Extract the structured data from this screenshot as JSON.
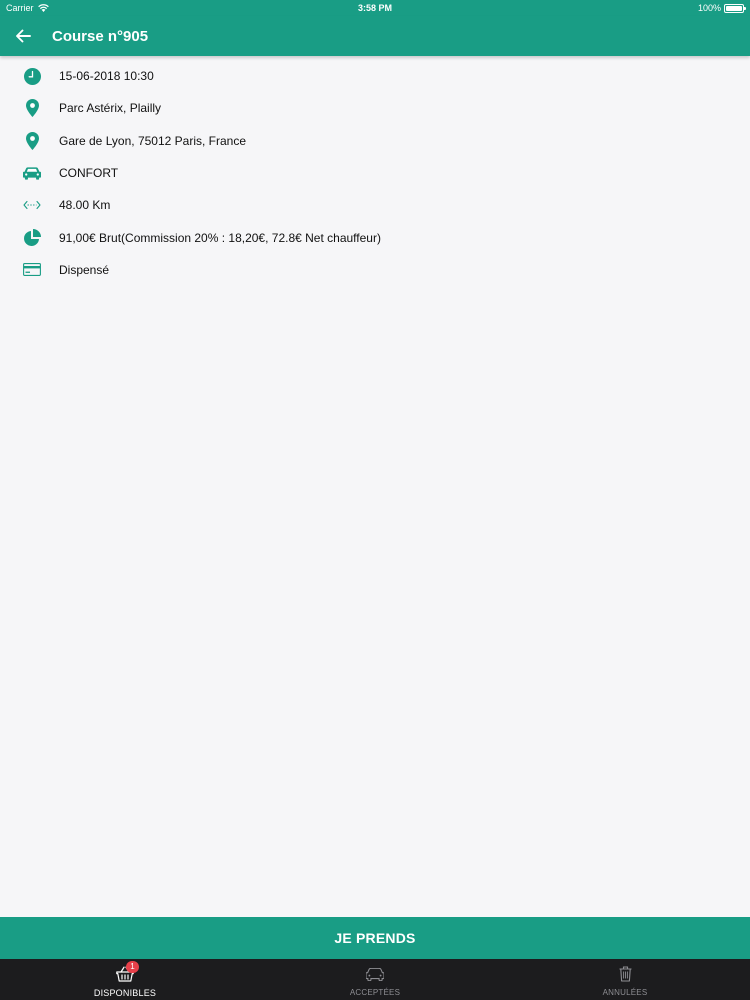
{
  "status_bar": {
    "carrier": "Carrier",
    "time": "3:58 PM",
    "battery": "100%"
  },
  "header": {
    "title": "Course n°905",
    "back_icon": "arrow-left-icon"
  },
  "details": {
    "items": [
      {
        "icon": "clock-icon",
        "text": "15-06-2018 10:30"
      },
      {
        "icon": "location-pin-icon",
        "text": "Parc Astérix, Plailly"
      },
      {
        "icon": "location-pin-icon",
        "text": "Gare de Lyon, 75012 Paris, France"
      },
      {
        "icon": "car-icon",
        "text": "CONFORT"
      },
      {
        "icon": "distance-icon",
        "text": "48.00 Km"
      },
      {
        "icon": "pie-chart-icon",
        "text": "91,00€ Brut(Commission 20% : 18,20€, 72.8€ Net chauffeur)"
      },
      {
        "icon": "credit-card-icon",
        "text": "Dispensé"
      }
    ]
  },
  "action": {
    "label": "JE PRENDS"
  },
  "tabs": [
    {
      "label": "DISPONIBLES",
      "icon": "basket-icon",
      "badge": "1",
      "active": true
    },
    {
      "label": "ACCEPTÉES",
      "icon": "car-icon",
      "active": false
    },
    {
      "label": "ANNULÉES",
      "icon": "trash-icon",
      "active": false
    }
  ],
  "colors": {
    "primary": "#199d85",
    "background": "#f6f6f8",
    "tab_bar": "#1c1c1e",
    "badge": "#e8404a"
  }
}
